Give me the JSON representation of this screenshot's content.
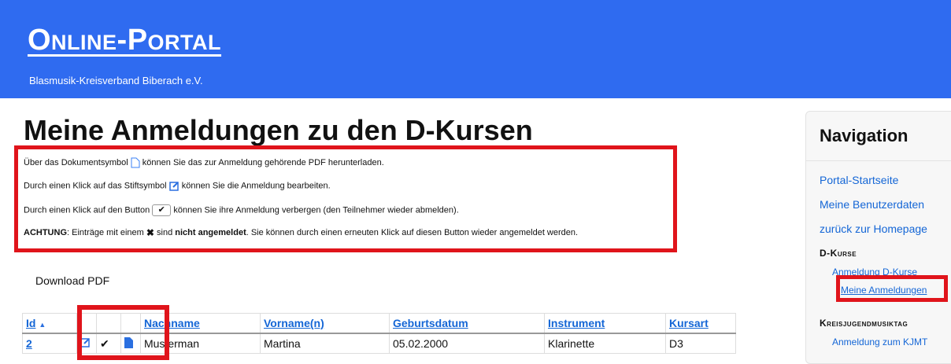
{
  "header": {
    "title": "Online-Portal",
    "subtitle": "Blasmusik-Kreisverband Biberach e.V."
  },
  "page": {
    "title": "Meine Anmeldungen zu den D-Kursen"
  },
  "info": {
    "line1_a": "Über das Dokumentsymbol",
    "line1_b": "können Sie das zur Anmeldung gehörende PDF herunterladen.",
    "line2_a": "Durch einen Klick auf das Stiftsymbol",
    "line2_b": "können Sie die Anmeldung bearbeiten.",
    "line3_a": "Durch einen Klick auf den Button",
    "line3_b": "können Sie ihre Anmeldung verbergen (den Teilnehmer wieder abmelden).",
    "line4_bold": "ACHTUNG",
    "line4_a": ": Einträge mit einem",
    "line4_b": "sind",
    "line4_bold2": "nicht angemeldet",
    "line4_c": ". Sie können durch einen erneuten Klick auf diesen Button wieder angemeldet werden."
  },
  "download_pdf": "Download PDF",
  "table": {
    "headers": {
      "id": "Id",
      "id_sort": "▲",
      "nachname": "Nachname",
      "vorname": "Vorname(n)",
      "geburtsdatum": "Geburtsdatum",
      "instrument": "Instrument",
      "kursart": "Kursart"
    },
    "rows": [
      {
        "id": "2",
        "nachname": "Musterman",
        "vorname": "Martina",
        "geburtsdatum": "05.02.2000",
        "instrument": "Klarinette",
        "kursart": "D3"
      }
    ]
  },
  "nav": {
    "title": "Navigation",
    "items": [
      "Portal-Startseite",
      "Meine Benutzerdaten",
      "zurück zur Homepage"
    ],
    "section1": "D-Kurse",
    "sub1": [
      "Anmeldung D-Kurse",
      "Meine Anmeldungen"
    ],
    "section2": "Kreisjugendmusiktag",
    "sub2": [
      "Anmeldung zum KJMT"
    ]
  },
  "colors": {
    "header_bg": "#2f6bf0",
    "highlight": "#e0141b",
    "link": "#1466d6"
  }
}
